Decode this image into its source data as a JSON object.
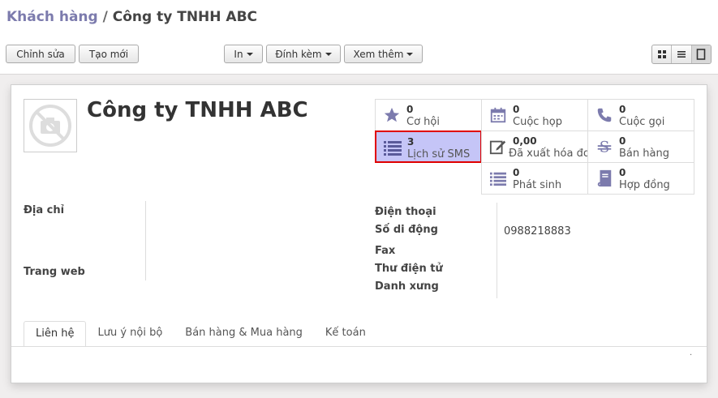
{
  "breadcrumb": {
    "parent": "Khách hàng",
    "separator": "/",
    "current": "Công ty TNHH ABC"
  },
  "toolbar": {
    "edit": "Chỉnh sửa",
    "create": "Tạo mới",
    "print": "In",
    "attach": "Đính kèm",
    "more": "Xem thêm"
  },
  "record": {
    "name": "Công ty TNHH ABC",
    "stats": [
      {
        "value": "0",
        "label": "Cơ hội",
        "icon": "star-icon"
      },
      {
        "value": "0",
        "label": "Cuộc họp",
        "icon": "calendar-icon"
      },
      {
        "value": "0",
        "label": "Cuộc gọi",
        "icon": "phone-icon"
      },
      {
        "value": "3",
        "label": "Lịch sử SMS",
        "icon": "list-icon"
      },
      {
        "value": "0,00",
        "label": "Đã xuất hóa đơn",
        "icon": "pencil-icon"
      },
      {
        "value": "0",
        "label": "Bán hàng",
        "icon": "dollar-icon"
      },
      {
        "value": "0",
        "label": "Phát sinh",
        "icon": "list-icon"
      },
      {
        "value": "0",
        "label": "Hợp đồng",
        "icon": "book-icon"
      }
    ],
    "fields_left": {
      "address": "Địa chỉ",
      "website": "Trang web"
    },
    "fields_right": {
      "phone": "Điện thoại",
      "mobile": "Số di động",
      "mobile_value": "0988218883",
      "fax": "Fax",
      "email": "Thư điện tử",
      "title": "Danh xưng"
    },
    "tabs": [
      "Liên hệ",
      "Lưu ý nội bộ",
      "Bán hàng & Mua hàng",
      "Kế toán"
    ],
    "tab_dot": "."
  },
  "colors": {
    "accent": "#7c7bad",
    "sms_highlight": "#c5c5f7",
    "sms_border": "#e00000",
    "icon": "#7c7bad"
  }
}
